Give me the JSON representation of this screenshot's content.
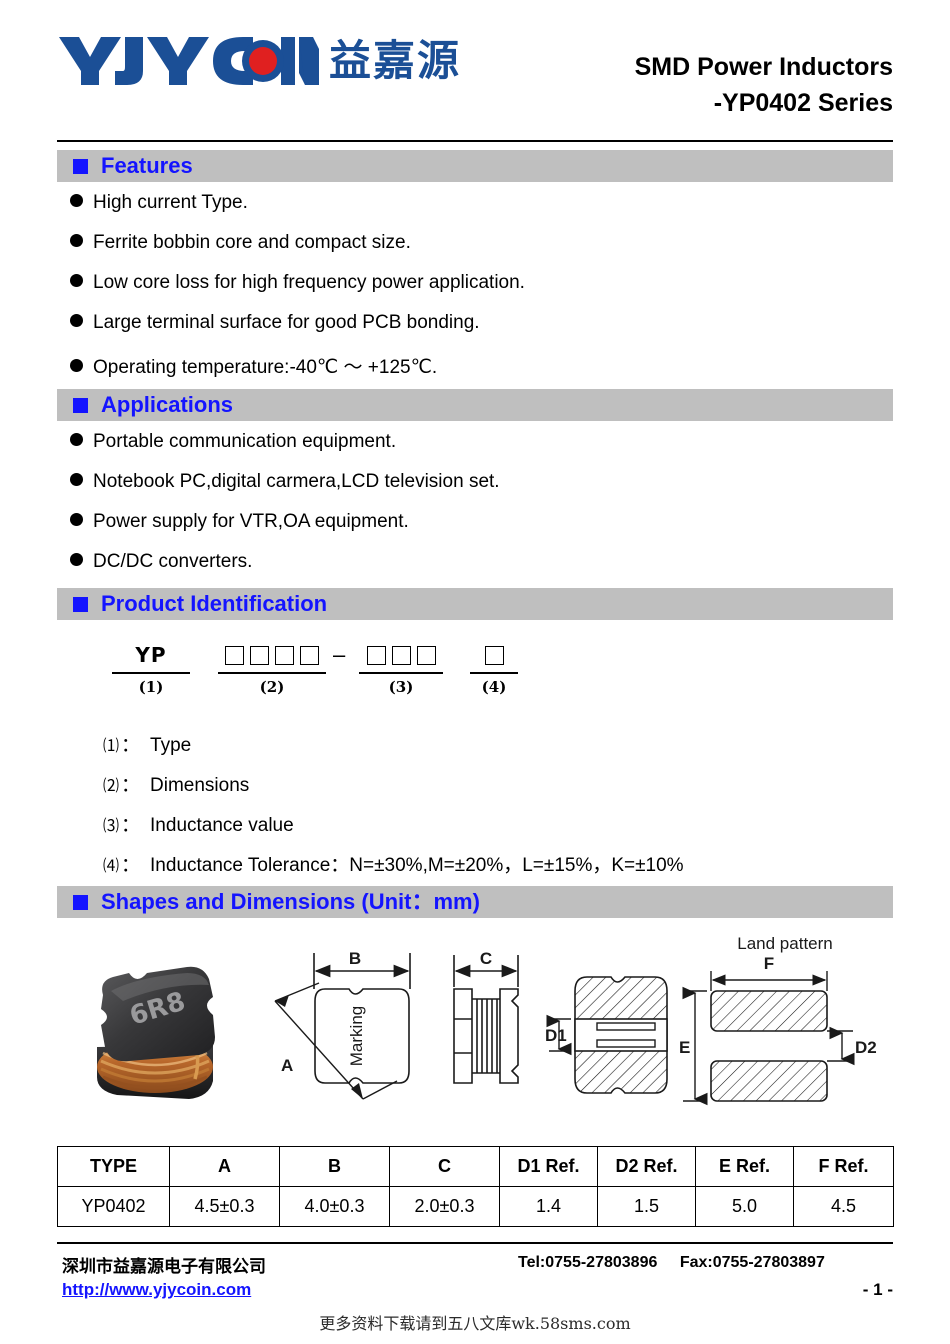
{
  "header": {
    "logo_text": "YJYCOIN",
    "logo_cn": "益嘉源",
    "title_line1": "SMD Power Inductors",
    "title_line2": "-YP0402 Series"
  },
  "sections": {
    "features": {
      "title": "Features",
      "items": [
        "High current Type.",
        "Ferrite bobbin core and compact size.",
        "Low core loss for high frequency power application.",
        "Large terminal surface for good PCB bonding.",
        "Operating temperature:-40℃ ～ +125℃."
      ]
    },
    "applications": {
      "title": "Applications",
      "items": [
        "Portable communication equipment.",
        "Notebook PC,digital carmera,LCD television set.",
        "Power supply for VTR,OA equipment.",
        "DC/DC converters."
      ]
    },
    "product_identification": {
      "title": "Product Identification",
      "part_prefix": "YP",
      "group_labels": [
        "(1)",
        "(2)",
        "(3)",
        "(4)"
      ],
      "group2_boxes": 4,
      "group3_boxes": 3,
      "group4_boxes": 1,
      "separator": "–",
      "legend": [
        {
          "index": "⑴",
          "sep": "：",
          "text": "Type"
        },
        {
          "index": "⑵",
          "sep": "：",
          "text": "Dimensions"
        },
        {
          "index": "⑶",
          "sep": "：",
          "text": "Inductance value"
        },
        {
          "index": "⑷",
          "sep": "：",
          "text": "Inductance Tolerance：N=±30%,M=±20%，L=±15%，K=±10%"
        }
      ]
    },
    "shapes": {
      "title": "Shapes and Dimensions (Unit：mm)",
      "photo_marking": "6R8",
      "top_view_marking": "Marking",
      "land_pattern_label": "Land pattern",
      "dimension_labels": {
        "a": "A",
        "b": "B",
        "c": "C",
        "d1": "D1",
        "d2": "D2",
        "e": "E",
        "f": "F"
      }
    }
  },
  "table": {
    "headers": [
      "TYPE",
      "A",
      "B",
      "C",
      "D1 Ref.",
      "D2 Ref.",
      "E Ref.",
      "F Ref."
    ],
    "rows": [
      [
        "YP0402",
        "4.5±0.3",
        "4.0±0.3",
        "2.0±0.3",
        "1.4",
        "1.5",
        "5.0",
        "4.5"
      ]
    ]
  },
  "footer": {
    "company": "深圳市益嘉源电子有限公司",
    "tel": "Tel:0755-27803896",
    "fax": "Fax:0755-27803897",
    "url": "http://www.yjycoin.com",
    "page": "- 1 -",
    "watermark": "更多资料下载请到五八文库wk.58sms.com"
  },
  "colors": {
    "accent_blue": "#1414ff",
    "logo_blue": "#1b4f96",
    "logo_red": "#e02020",
    "section_bar": "#bfbfbf"
  }
}
